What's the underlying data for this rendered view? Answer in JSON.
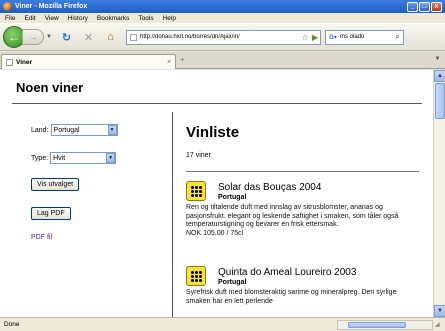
{
  "window": {
    "title": "Viner - Mozilla Firefox",
    "minimize": "_",
    "maximize": "□",
    "close": "x"
  },
  "menu": [
    "File",
    "Edit",
    "View",
    "History",
    "Bookmarks",
    "Tools",
    "Help"
  ],
  "toolbar": {
    "url": "http://donau.hiof.no/borres/dn/Ajax/in/",
    "search_value": "ms olado"
  },
  "tabs": [
    {
      "label": "Viner"
    }
  ],
  "page": {
    "heading": "Noen viner",
    "form": {
      "land_label": "Land:",
      "land_value": "Portugal",
      "type_label": "Type:",
      "type_value": "Hvit",
      "show_button": "Vis utvalget",
      "pdf_button": "Lag PDF",
      "pdf_link": "PDF fil"
    },
    "list": {
      "title": "Vinliste",
      "count": "17 viner"
    },
    "wines": [
      {
        "name": "Solar das Bouças 2004",
        "country": "Portugal",
        "description": "Ren og tiltalende duft med innslag av sitrusblomster, ananas og pasjonsfrukt. elegant og leskende saftighet i smaken, som tåler også temperaturstigning og bevarer en frisk ettersmak.",
        "price": "NOK 105.00 / 75cl"
      },
      {
        "name": "Quinta do Ameal Loureiro 2003",
        "country": "Portugal",
        "description": "Syrefrisk duft med blomsteraktig sarime og mineralpreg. Den syrlige smaken har en lett perlende",
        "price": ""
      }
    ]
  },
  "status": {
    "text": "Done"
  }
}
